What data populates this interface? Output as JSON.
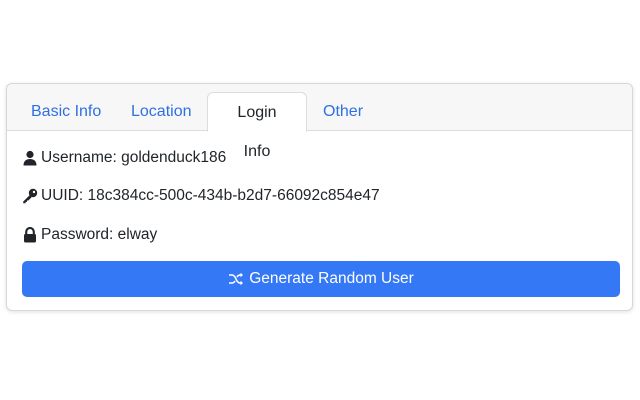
{
  "tabs": [
    {
      "label": "Basic Info",
      "active": false
    },
    {
      "label": "Location",
      "active": false
    },
    {
      "label": "Login Info",
      "active": true
    },
    {
      "label": "Other",
      "active": false
    }
  ],
  "login": {
    "username": "Username: goldenduck186",
    "uuid": "UUID: 18c384cc-500c-434b-b2d7-66092c854e47",
    "password": "Password: elway"
  },
  "button": {
    "label": "Generate Random User",
    "icon": "shuffle-icon"
  },
  "icons": {
    "username": "user-icon",
    "uuid": "key-icon",
    "password": "lock-icon"
  },
  "colors": {
    "accent": "#3478f6",
    "tab_link": "#2f6fe4"
  }
}
